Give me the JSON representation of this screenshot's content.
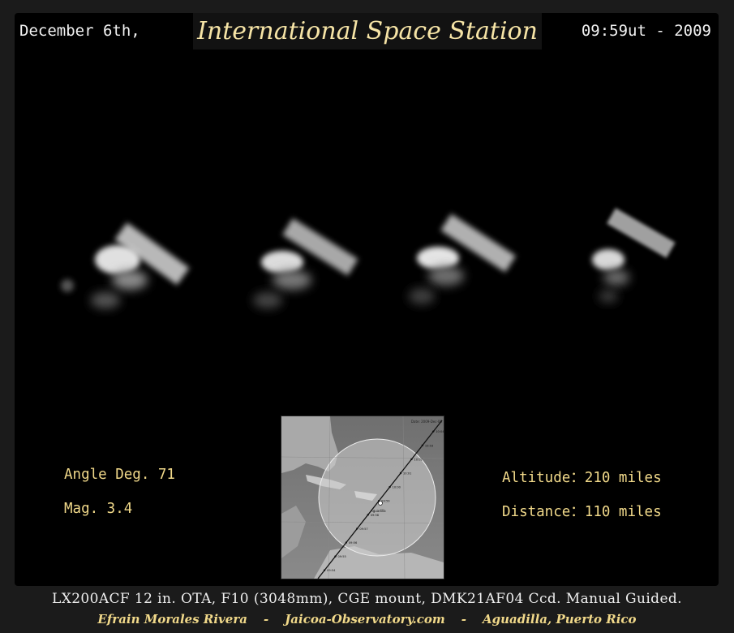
{
  "header": {
    "date": "December 6th,",
    "title": "International Space Station",
    "time": "09:59ut - 2009"
  },
  "observation": {
    "angle": "Angle Deg. 71",
    "mag": "Mag. 3.4",
    "altitude": "Altitude：210 miles",
    "distance": "Distance：110 miles"
  },
  "map": {
    "top_label": "Date: 2009-Dec-06",
    "time_marks": [
      "09:54",
      "09:55",
      "09:56",
      "09:57",
      "09:58",
      "09:59",
      "10:00",
      "10:01",
      "10:02",
      "10:03",
      "10:04"
    ],
    "place_label": "Aguadilla"
  },
  "footer": {
    "specs": "LX200ACF 12 in. OTA, F10 (3048mm), CGE mount, DMK21AF04 Ccd. Manual Guided.",
    "author": "Efrain Morales Rivera",
    "site": "Jaicoa-Observatory.com",
    "location": "Aguadilla, Puerto Rico",
    "separator": "-"
  },
  "colors": {
    "background": "#000000",
    "title_gold": "#f6e4a6",
    "info_gold": "#f1d98a",
    "white_text": "#f2f2f2"
  }
}
